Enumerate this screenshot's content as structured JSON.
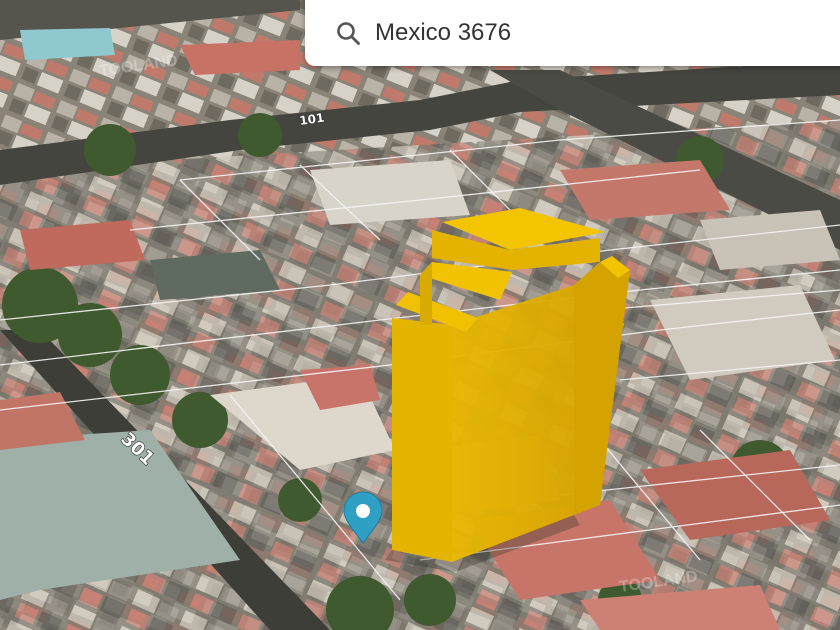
{
  "search": {
    "value": "Mexico 3676",
    "icon": "search-icon"
  },
  "map": {
    "view": "3d-satellite",
    "street_labels": [
      "101",
      "301"
    ],
    "watermark": "TOOLAND",
    "building_color": "#f2c500",
    "marker_color": "#2f9fc4",
    "marker_icon": "location-pin-icon"
  }
}
